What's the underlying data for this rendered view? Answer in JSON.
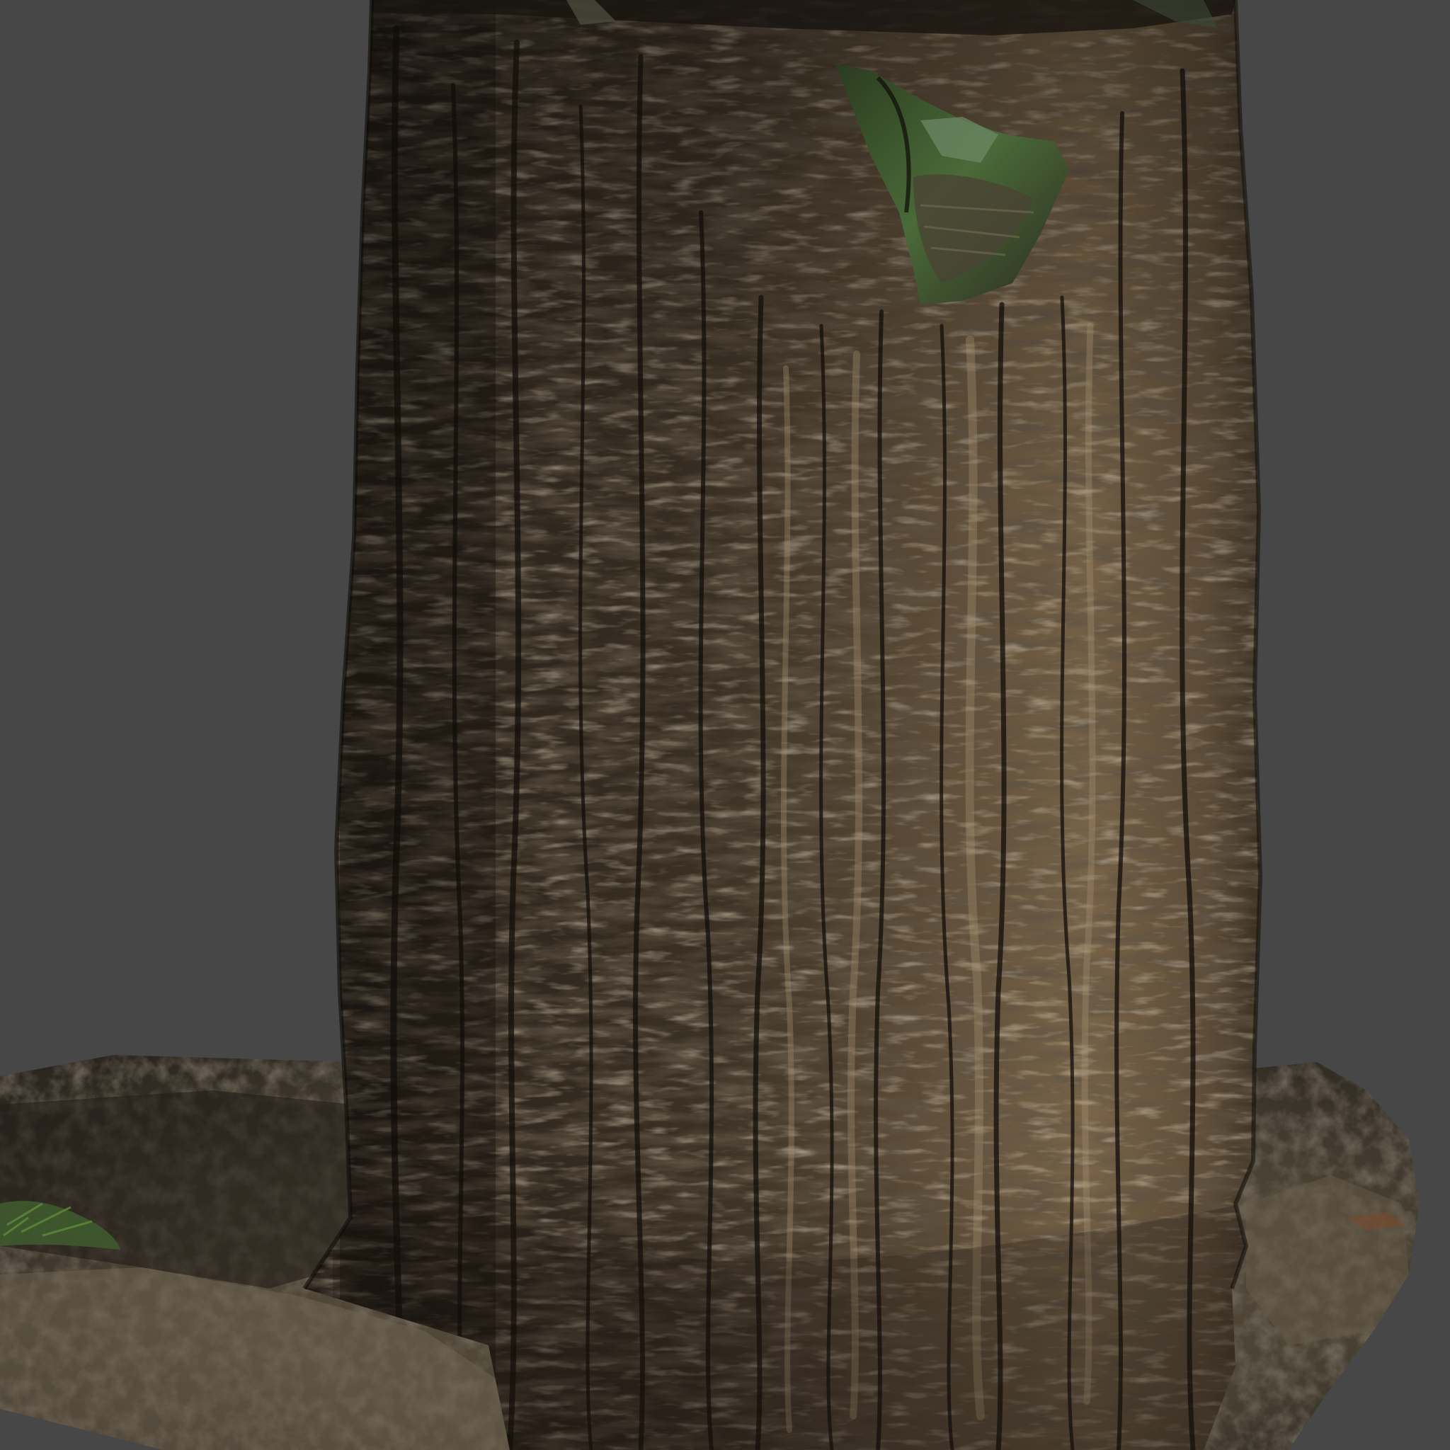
{
  "scene": {
    "subject": "tree-trunk-scan",
    "background_color": "#474747",
    "colors": {
      "bark_dark": "#1f1a14",
      "bark_mid": "#4a3d2d",
      "bark_light": "#8a7658",
      "bark_highlight": "#b09a78",
      "ground_dark": "#2e2820",
      "ground_light": "#6e6350",
      "moss_green": "#3f5a2e",
      "grass_green": "#4e7a34"
    }
  }
}
